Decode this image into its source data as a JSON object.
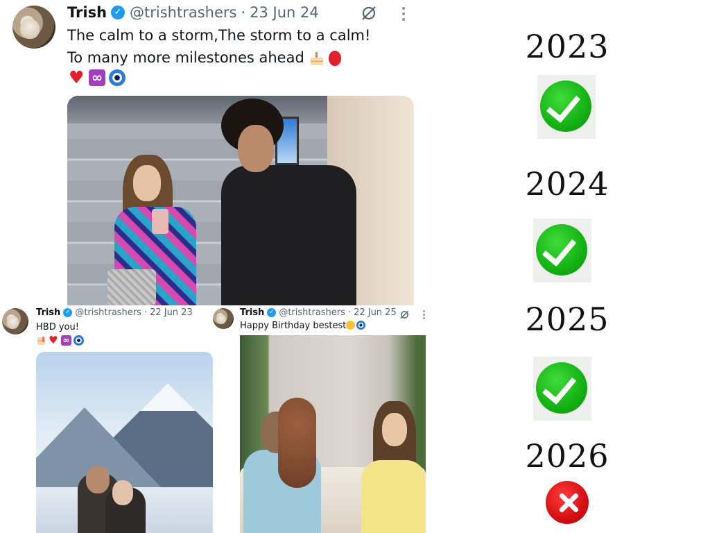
{
  "main_tweet": {
    "name": "Trish",
    "handle": "@trishtrashers",
    "separator": "·",
    "date": "23 Jun 24",
    "line1": "The calm to a storm,The storm to a calm!",
    "line2": "To many more milestones ahead",
    "emoji_icons": [
      "birthday-cake-icon",
      "red-balloon-icon",
      "red-heart-icon",
      "infinity-icon",
      "nazar-amulet-icon"
    ]
  },
  "tweet_2023": {
    "name": "Trish",
    "handle": "@trishtrashers",
    "separator": "·",
    "date": "22 Jun 23",
    "text": "HBD you!",
    "emoji_icons": [
      "birthday-cake-icon",
      "red-heart-icon",
      "infinity-icon",
      "nazar-amulet-icon"
    ]
  },
  "tweet_2025": {
    "name": "Trish",
    "handle": "@trishtrashers",
    "separator": "·",
    "date": "22 Jun 25",
    "text": "Happy Birthday bestest",
    "emoji_icons": [
      "hugging-face-icon",
      "nazar-amulet-icon"
    ]
  },
  "years": [
    {
      "year": "2023",
      "status": "check"
    },
    {
      "year": "2024",
      "status": "check"
    },
    {
      "year": "2025",
      "status": "check"
    },
    {
      "year": "2026",
      "status": "cross"
    }
  ],
  "colors": {
    "verified": "#1d9bf0",
    "check": "#14b114",
    "cross": "#d40f12",
    "secondary_text": "#536471"
  }
}
